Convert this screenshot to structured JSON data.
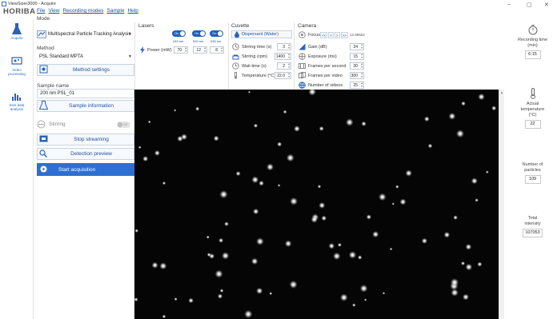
{
  "window": {
    "title": "ViewSizer3000 - Acquire",
    "brand": "HORIBA",
    "controls": {
      "minimize": "–",
      "maximize": "▢",
      "close": "✕"
    }
  },
  "menu": [
    "File",
    "View",
    "Recording modes",
    "Sample",
    "Help"
  ],
  "nav": {
    "acquire": "Acquire",
    "video_processing_1": "Video",
    "video_processing_2": "processing",
    "size_data_1": "Size data",
    "size_data_2": "analysis"
  },
  "mode": {
    "label": "Mode",
    "value": "Multispectral Particle Tracking Analysis"
  },
  "method": {
    "label": "Method",
    "value": "PSL Standard MPTA",
    "settings_button": "Method settings"
  },
  "sample": {
    "label": "Sample name",
    "value": "200 nm PSL_01",
    "info_button": "Sample information"
  },
  "stirring": {
    "label": "Stirring",
    "toggle": "Off"
  },
  "actions": {
    "stop_streaming": "Stop streaming",
    "detection_preview": "Detection preview",
    "start_acquisition": "Start acquisition"
  },
  "lasers": {
    "title": "Lasers",
    "toggles": [
      {
        "state": "On",
        "wavelength": "445 nm"
      },
      {
        "state": "On",
        "wavelength": "520 nm"
      },
      {
        "state": "On",
        "wavelength": "635 nm"
      }
    ],
    "power_label": "Power (mW)",
    "powers": [
      "70",
      "12",
      "8"
    ]
  },
  "cuvette": {
    "title": "Cuvette",
    "dispersant_button": "Dispersant (Water)",
    "rows": [
      {
        "label": "Stirring time (s)",
        "value": "3"
      },
      {
        "label": "Stirring (rpm)",
        "value": "1400"
      },
      {
        "label": "Wait time (s)",
        "value": "2"
      },
      {
        "label": "Temperature (°C)",
        "value": "22.0"
      }
    ]
  },
  "camera": {
    "title": "Camera",
    "focus_label": "Focus",
    "focus_buttons": [
      "<<",
      "<",
      ">",
      ">>"
    ],
    "focus_value": "12.89502",
    "rows": [
      {
        "label": "Gain (dB)",
        "value": "24"
      },
      {
        "label": "Exposure (ms)",
        "value": "15"
      },
      {
        "label": "Frames per second",
        "value": "30"
      },
      {
        "label": "Frames per video",
        "value": "300"
      },
      {
        "label": "Number of videos",
        "value": "25"
      }
    ]
  },
  "stats": {
    "recording_time": {
      "label_1": "Recording time",
      "label_2": "(min)",
      "value": "6:15"
    },
    "temperature": {
      "label_1": "Actual",
      "label_2": "temperature",
      "label_3": "(°C)",
      "value": "22"
    },
    "particles": {
      "label_1": "Number of",
      "label_2": "particles",
      "value": "109"
    },
    "intensity": {
      "label_1": "Total",
      "label_2": "intensity",
      "value": "107053"
    }
  },
  "colors": {
    "accent": "#2d6fd2",
    "link": "#1c4e9a",
    "video_bg": "#050505"
  }
}
